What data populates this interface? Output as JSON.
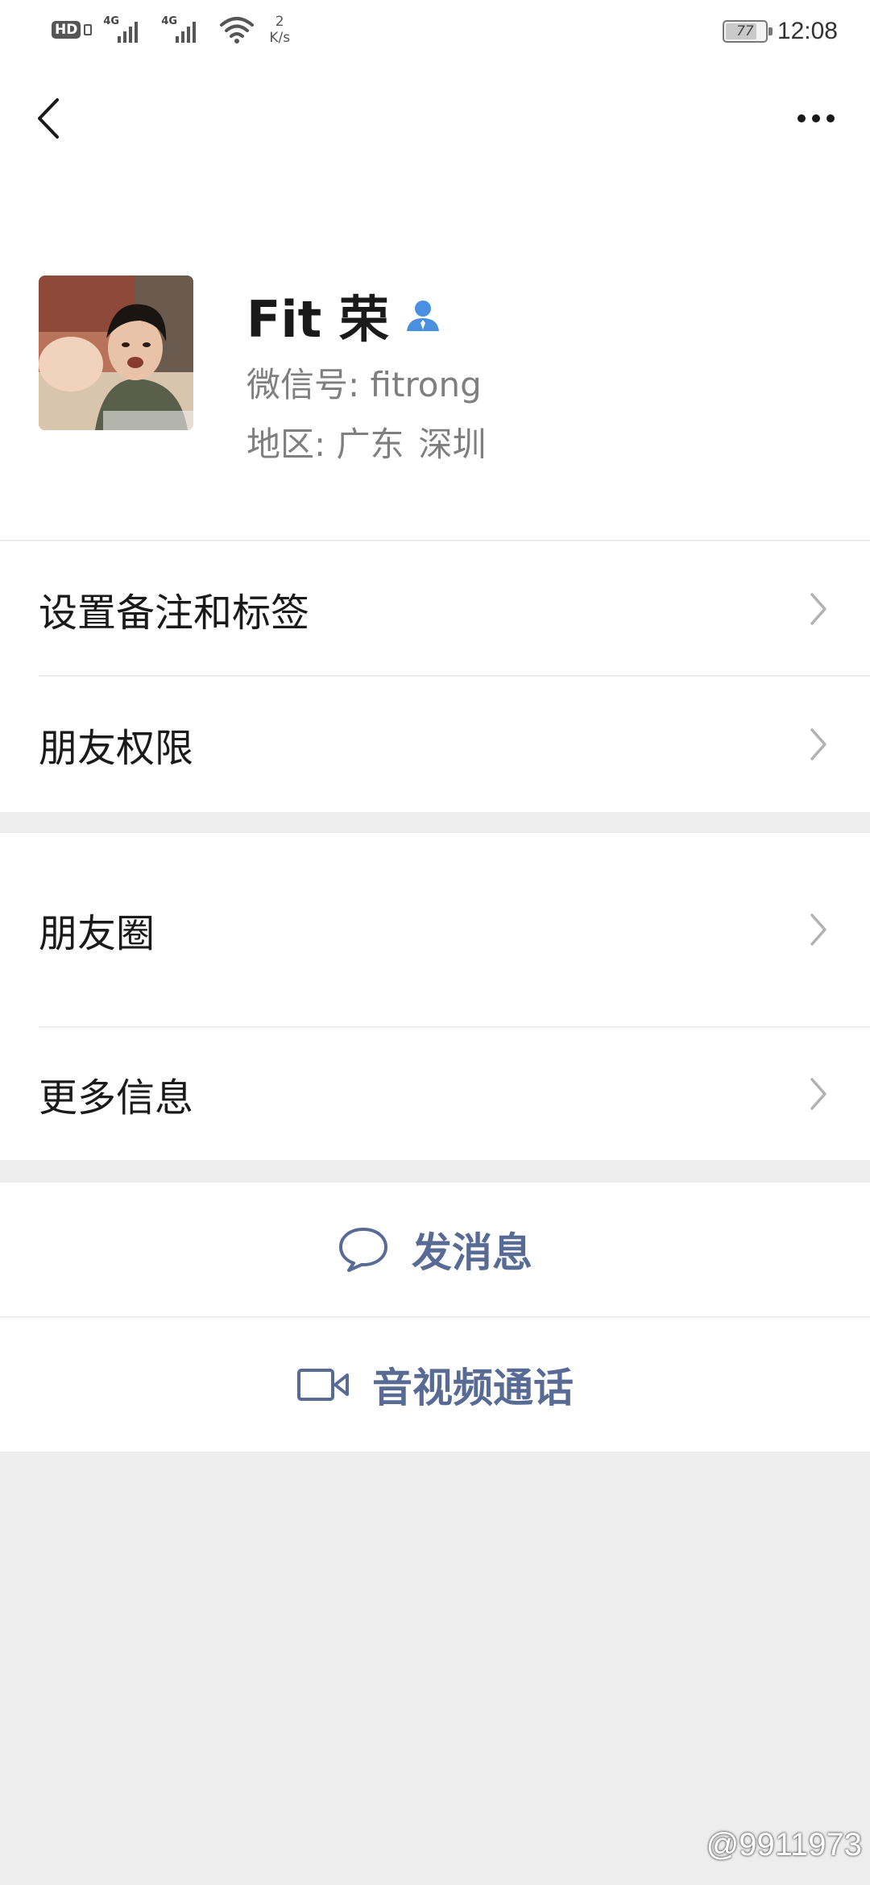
{
  "status_bar": {
    "hd_label": "HD",
    "network_1": "4G",
    "network_2": "4G",
    "speed_value": "2",
    "speed_unit": "K/s",
    "battery_level": "77",
    "time": "12:08"
  },
  "nav": {
    "back_icon": "chevron-left-icon",
    "more_icon": "more-dots-icon"
  },
  "profile": {
    "name": "Fit 荣",
    "wechat_id_label": "微信号:",
    "wechat_id": "fitrong",
    "region_label": "地区:",
    "region_province": "广东",
    "region_city": "深圳",
    "contact_icon": "person-icon"
  },
  "menu_group_1": [
    {
      "label": "设置备注和标签"
    },
    {
      "label": "朋友权限"
    }
  ],
  "menu_group_2": [
    {
      "label": "朋友圈"
    },
    {
      "label": "更多信息"
    }
  ],
  "actions": {
    "message_label": "发消息",
    "message_icon": "chat-bubble-icon",
    "call_label": "音视频通话",
    "call_icon": "video-camera-icon"
  },
  "watermark": "@9911973",
  "colors": {
    "link_blue": "#576b95",
    "background": "#ededed",
    "contact_badge": "#4a90e2"
  }
}
